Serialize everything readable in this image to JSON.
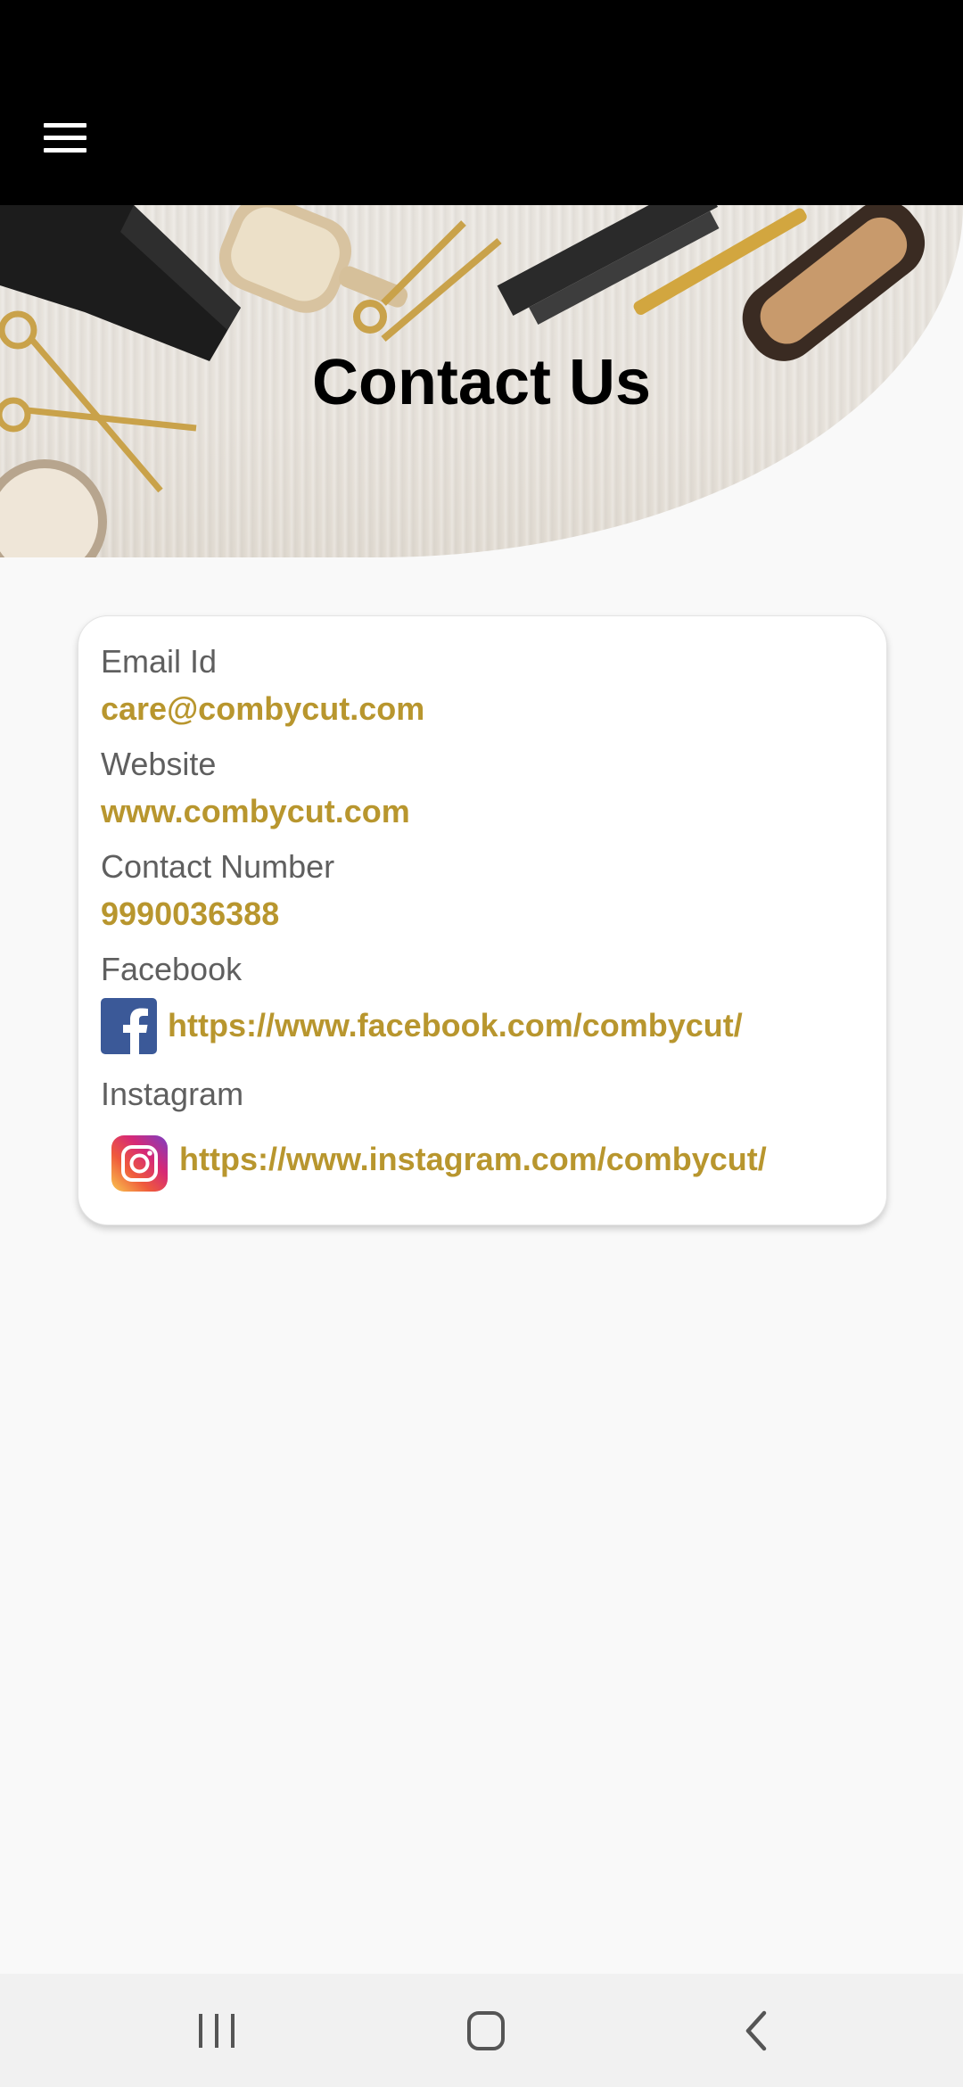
{
  "header": {
    "menu_icon": "hamburger-menu-icon",
    "background_color": "#000000"
  },
  "hero": {
    "title": "Contact Us"
  },
  "contact": {
    "email": {
      "label": "Email Id",
      "value": "care@combycut.com"
    },
    "website": {
      "label": "Website",
      "value": "www.combycut.com"
    },
    "phone": {
      "label": "Contact Number",
      "value": "9990036388"
    },
    "facebook": {
      "label": "Facebook",
      "icon": "facebook-icon",
      "value": "https://www.facebook.com/combycut/"
    },
    "instagram": {
      "label": "Instagram",
      "icon": "instagram-icon",
      "value": "https://www.instagram.com/combycut/"
    }
  },
  "system_nav": {
    "recents_icon": "recent-apps-icon",
    "home_icon": "home-icon",
    "back_icon": "back-icon"
  },
  "colors": {
    "accent": "#b8962e",
    "label": "#5f5f5f",
    "page_background": "#f9f9f9",
    "facebook_blue": "#3b5998"
  }
}
